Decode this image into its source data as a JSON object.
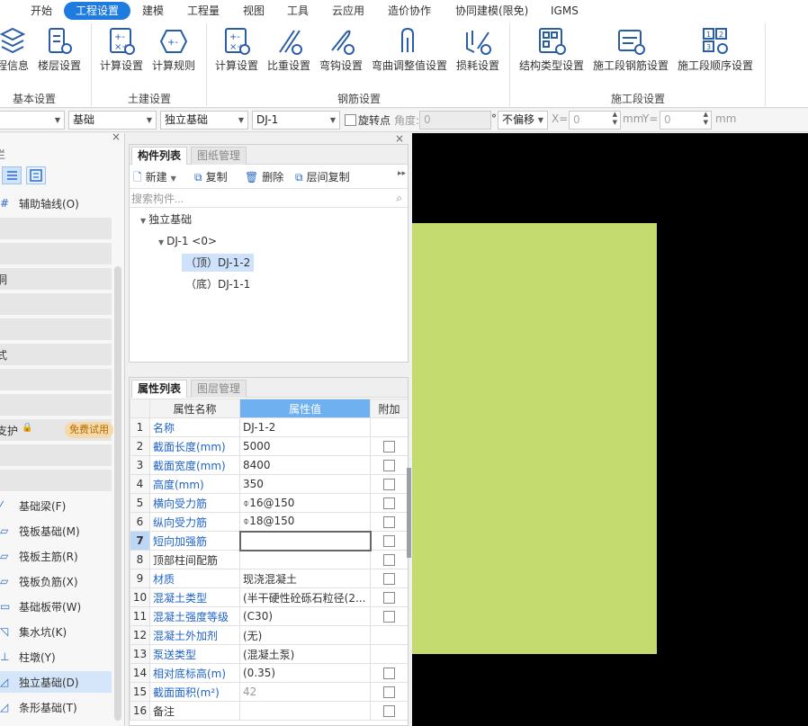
{
  "menu": {
    "items": [
      "开始",
      "工程设置",
      "建模",
      "工程量",
      "视图",
      "工具",
      "云应用",
      "造价协作",
      "协同建模(限免)",
      "IGMS"
    ],
    "active": "工程设置"
  },
  "ribbon": {
    "groups": [
      {
        "label": "基本设置",
        "buttons": [
          "程信息",
          "楼层设置"
        ]
      },
      {
        "label": "土建设置",
        "buttons": [
          "计算设置",
          "计算规则"
        ]
      },
      {
        "label": "钢筋设置",
        "buttons": [
          "计算设置",
          "比重设置",
          "弯钩设置",
          "弯曲调整值设置",
          "损耗设置"
        ]
      },
      {
        "label": "施工段设置",
        "buttons": [
          "结构类型设置",
          "施工段钢筋设置",
          "施工段顺序设置"
        ]
      }
    ]
  },
  "toolbar": {
    "combo1": "",
    "combo2": "基础",
    "combo3": "独立基础",
    "combo4": "DJ-1",
    "rotate_label": "旋转点",
    "angle_label": "角度:",
    "angle_value": "0",
    "degree": "°",
    "offset": "不偏移",
    "x_label": "X=",
    "x_value": "0",
    "mm1": "mm",
    "y_label": "Y=",
    "y_value": "0",
    "mm2": "mm"
  },
  "left_panel": {
    "title": "栏",
    "rows": [
      {
        "text": "辅助轴线(O)",
        "icon": "axis-icon"
      },
      {
        "text": ""
      },
      {
        "text": ""
      },
      {
        "text": "洞"
      },
      {
        "text": ""
      },
      {
        "text": ""
      },
      {
        "text": "式"
      },
      {
        "text": ""
      },
      {
        "text": ""
      },
      {
        "text": "支护",
        "lock": "🔒",
        "badge": "免费试用"
      },
      {
        "text": ""
      },
      {
        "text": ""
      },
      {
        "text": "基础梁(F)",
        "icon": "foundation-beam-icon"
      },
      {
        "text": "筏板基础(M)",
        "icon": "raft-foundation-icon"
      },
      {
        "text": "筏板主筋(R)",
        "icon": "raft-main-rebar-icon"
      },
      {
        "text": "筏板负筋(X)",
        "icon": "raft-negative-rebar-icon"
      },
      {
        "text": "基础板带(W)",
        "icon": "foundation-strip-icon"
      },
      {
        "text": "集水坑(K)",
        "icon": "sump-pit-icon"
      },
      {
        "text": "柱墩(Y)",
        "icon": "column-pier-icon"
      },
      {
        "text": "独立基础(D)",
        "icon": "isolated-foundation-icon"
      },
      {
        "text": "条形基础(T)",
        "icon": "strip-foundation-icon"
      }
    ]
  },
  "component_panel": {
    "tabs": [
      "构件列表",
      "图纸管理"
    ],
    "tools": [
      "新建",
      "复制",
      "删除",
      "层间复制"
    ],
    "search_placeholder": "搜索构件...",
    "tree": {
      "root": "独立基础",
      "child": "DJ-1 <0>",
      "leaves": [
        "（顶）DJ-1-2",
        "（底）DJ-1-1"
      ]
    }
  },
  "property_panel": {
    "tabs": [
      "属性列表",
      "图层管理"
    ],
    "headers": [
      "属性名称",
      "属性值",
      "附加"
    ],
    "rows": [
      {
        "n": "1",
        "name": "名称",
        "value": "DJ-1-2",
        "check": false
      },
      {
        "n": "2",
        "name": "截面长度(mm)",
        "value": "5000",
        "check": true
      },
      {
        "n": "3",
        "name": "截面宽度(mm)",
        "value": "8400",
        "check": true
      },
      {
        "n": "4",
        "name": "高度(mm)",
        "value": "350",
        "check": true
      },
      {
        "n": "5",
        "name": "横向受力筋",
        "value": "⌽16@150",
        "check": true
      },
      {
        "n": "6",
        "name": "纵向受力筋",
        "value": "⌽18@150",
        "check": true
      },
      {
        "n": "7",
        "name": "短向加强筋",
        "value": "",
        "check": true
      },
      {
        "n": "8",
        "name": "顶部柱间配筋",
        "value": "",
        "check": true
      },
      {
        "n": "9",
        "name": "材质",
        "value": "现浇混凝土",
        "check": true
      },
      {
        "n": "10",
        "name": "混凝土类型",
        "value": "(半干硬性砼砾石粒径(2...",
        "check": true
      },
      {
        "n": "11",
        "name": "混凝土强度等级",
        "value": "(C30)",
        "check": true
      },
      {
        "n": "12",
        "name": "混凝土外加剂",
        "value": "(无)",
        "check": false
      },
      {
        "n": "13",
        "name": "泵送类型",
        "value": "(混凝土泵)",
        "check": false
      },
      {
        "n": "14",
        "name": "相对底标高(m)",
        "value": "(0.35)",
        "check": true
      },
      {
        "n": "15",
        "name": "截面面积(m²)",
        "value": "42",
        "check": true
      },
      {
        "n": "16",
        "name": "备注",
        "value": "",
        "check": true
      }
    ]
  },
  "colors": {
    "accent": "#1e7be0",
    "canvas_bg": "#000000",
    "shape_fill": "#c4dc6f"
  }
}
